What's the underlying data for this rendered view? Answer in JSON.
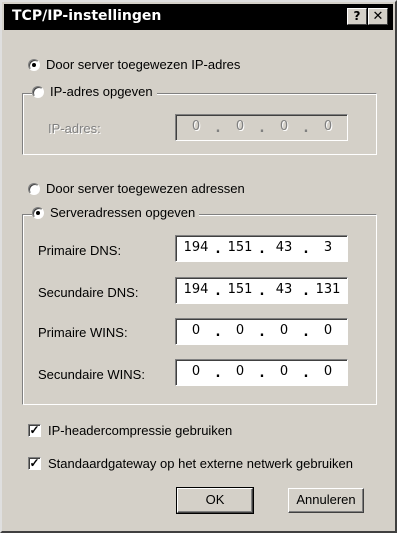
{
  "window": {
    "title": "TCP/IP-instellingen",
    "help_glyph": "?",
    "close_glyph": "✕"
  },
  "ip_section": {
    "radio_server_assigned": "Door server toegewezen IP-adres",
    "radio_specify": "IP-adres opgeven",
    "ip_label": "IP-adres:",
    "ip_address": [
      "0",
      "0",
      "0",
      "0"
    ]
  },
  "dns_section": {
    "radio_server_assigned": "Door server toegewezen adressen",
    "radio_specify": "Serveradressen opgeven",
    "primary_dns_label": "Primaire DNS:",
    "primary_dns": [
      "194",
      "151",
      "43",
      "3"
    ],
    "secondary_dns_label": "Secundaire DNS:",
    "secondary_dns": [
      "194",
      "151",
      "43",
      "131"
    ],
    "primary_wins_label": "Primaire WINS:",
    "primary_wins": [
      "0",
      "0",
      "0",
      "0"
    ],
    "secondary_wins_label": "Secundaire WINS:",
    "secondary_wins": [
      "0",
      "0",
      "0",
      "0"
    ]
  },
  "options": {
    "header_compression": "IP-headercompressie gebruiken",
    "default_gateway": "Standaardgateway op het externe netwerk gebruiken",
    "check_glyph": "✓"
  },
  "buttons": {
    "ok": "OK",
    "cancel": "Annuleren"
  }
}
